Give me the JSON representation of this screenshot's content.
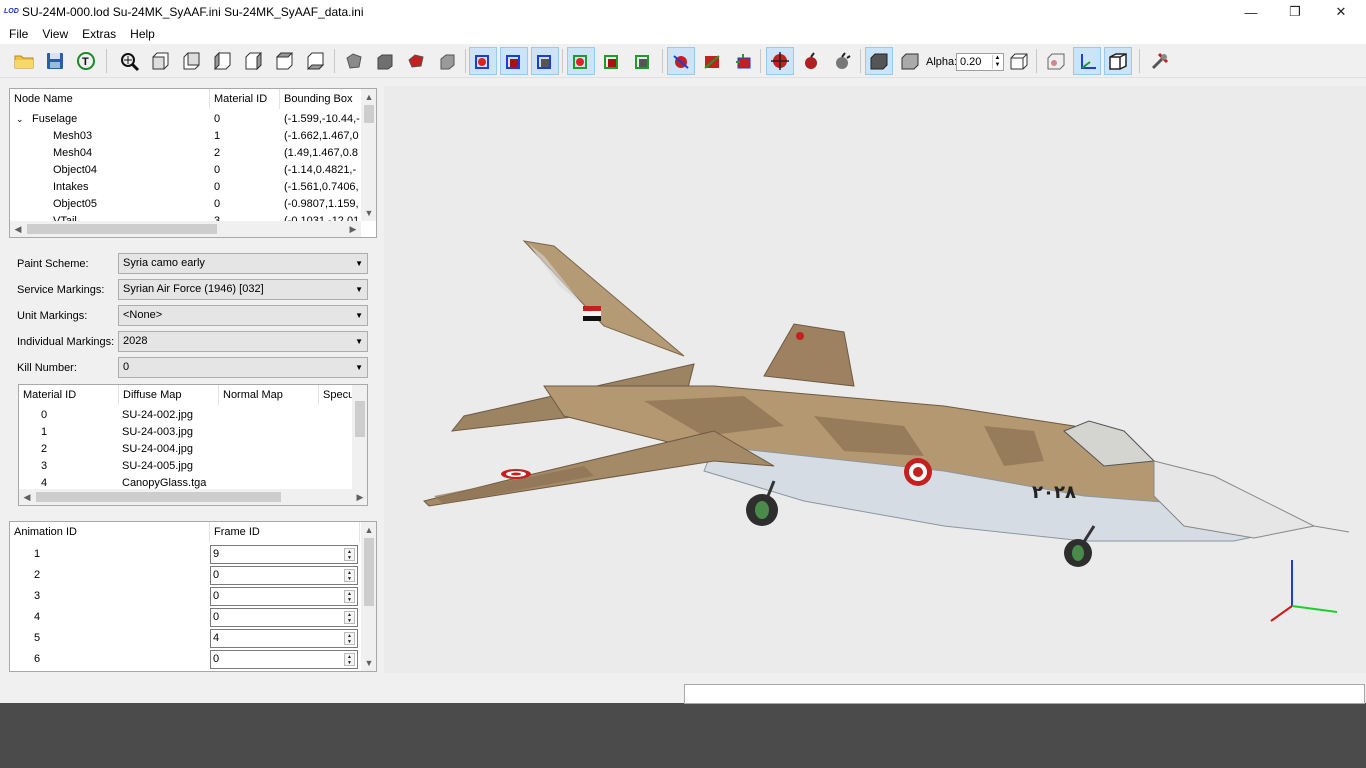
{
  "window": {
    "title": "SU-24M-000.lod  Su-24MK_SyAAF.ini  Su-24MK_SyAAF_data.ini",
    "logo_text": "LOD",
    "minimize": "—",
    "maximize": "❐",
    "close": "✕"
  },
  "menu": [
    "File",
    "View",
    "Extras",
    "Help"
  ],
  "toolbar": {
    "alpha_label": "Alpha:",
    "alpha_value": "0.20",
    "icons": [
      "open-icon",
      "save-icon",
      "texture-icon",
      "zoom-fit-icon",
      "view-front-icon",
      "view-back-icon",
      "view-left-icon",
      "view-right-icon",
      "view-top-icon",
      "view-bottom-icon",
      "shape-icon",
      "solid-cube-icon",
      "red-shape-icon",
      "gray-shape-icon",
      "bbox-red-icon",
      "bbox-blue-icon",
      "bbox-blue2-icon",
      "bbox-green-icon",
      "bbox-green2-icon",
      "bbox-green3-icon",
      "hit-icon",
      "normals-icon",
      "lights-icon",
      "target-icon",
      "bomb-icon",
      "burst-icon",
      "solid-box-icon",
      "wire-box-icon",
      "transparent-box-icon",
      "texture-view-icon",
      "axes-icon",
      "perspective-icon",
      "tools-icon"
    ]
  },
  "node_tree": {
    "headers": [
      "Node Name",
      "Material ID",
      "Bounding Box"
    ],
    "rows": [
      {
        "name": "Fuselage",
        "mat": "0",
        "bbox": "(-1.599,-10.44,-",
        "level": 0,
        "expanded": true
      },
      {
        "name": "Mesh03",
        "mat": "1",
        "bbox": "(-1.662,1.467,0",
        "level": 1
      },
      {
        "name": "Mesh04",
        "mat": "2",
        "bbox": "(1.49,1.467,0.8",
        "level": 1
      },
      {
        "name": "Object04",
        "mat": "0",
        "bbox": "(-1.14,0.4821,-",
        "level": 1
      },
      {
        "name": "Intakes",
        "mat": "0",
        "bbox": "(-1.561,0.7406,",
        "level": 1
      },
      {
        "name": "Object05",
        "mat": "0",
        "bbox": "(-0.9807,1.159,",
        "level": 1
      },
      {
        "name": "VTail",
        "mat": "3",
        "bbox": "(-0.1031,-12.01",
        "level": 1,
        "expanded": true
      }
    ]
  },
  "form": {
    "paint_scheme": {
      "label": "Paint Scheme:",
      "value": "Syria camo early"
    },
    "service_markings": {
      "label": "Service Markings:",
      "value": "Syrian Air Force (1946) [032]"
    },
    "unit_markings": {
      "label": "Unit Markings:",
      "value": "<None>"
    },
    "individual_markings": {
      "label": "Individual Markings:",
      "value": "2028"
    },
    "kill_number": {
      "label": "Kill Number:",
      "value": "0"
    }
  },
  "materials": {
    "headers": [
      "Material ID",
      "Diffuse Map",
      "Normal Map",
      "Specu"
    ],
    "rows": [
      {
        "id": "0",
        "diffuse": "SU-24-002.jpg"
      },
      {
        "id": "1",
        "diffuse": "SU-24-003.jpg"
      },
      {
        "id": "2",
        "diffuse": "SU-24-004.jpg"
      },
      {
        "id": "3",
        "diffuse": "SU-24-005.jpg"
      },
      {
        "id": "4",
        "diffuse": "CanopyGlass.tga"
      }
    ]
  },
  "animations": {
    "headers": [
      "Animation ID",
      "Frame ID"
    ],
    "rows": [
      {
        "id": "1",
        "frame": "9"
      },
      {
        "id": "2",
        "frame": "0"
      },
      {
        "id": "3",
        "frame": "0"
      },
      {
        "id": "4",
        "frame": "0"
      },
      {
        "id": "5",
        "frame": "4"
      },
      {
        "id": "6",
        "frame": "0"
      }
    ]
  },
  "aircraft": {
    "tail_code_arabic": "٢٠٢٨"
  }
}
